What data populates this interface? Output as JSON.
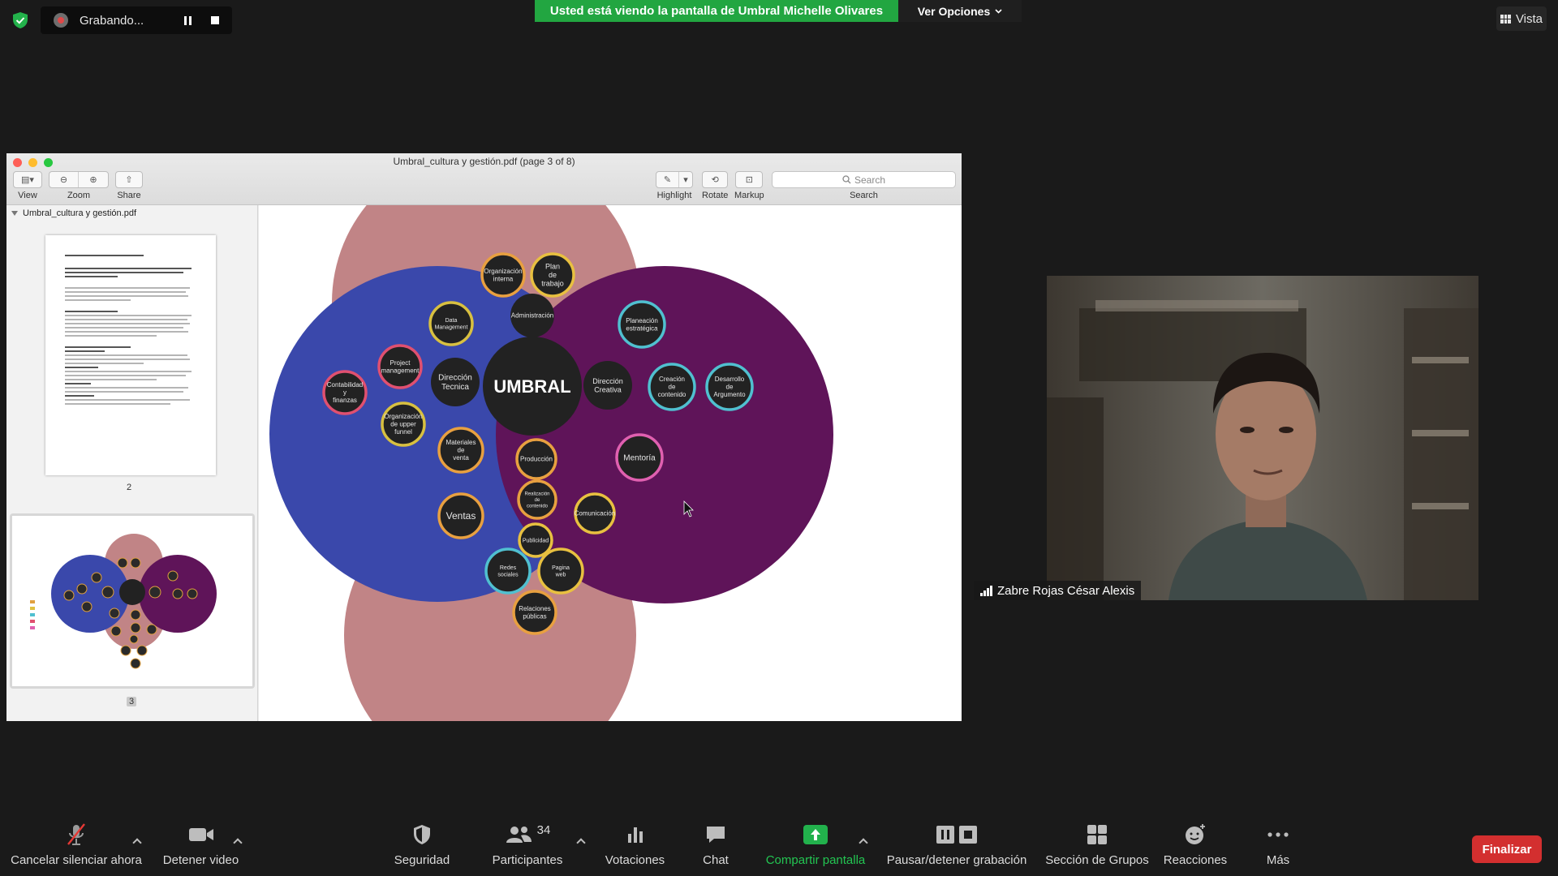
{
  "top": {
    "recording_label": "Grabando...",
    "share_banner": "Usted está viendo la pantalla de Umbral Michelle Olivares",
    "view_options": "Ver Opciones",
    "view_button": "Vista"
  },
  "preview": {
    "window_title": "Umbral_cultura y gestión.pdf (page 3 of 8)",
    "toolbar": {
      "view_label": "View",
      "zoom_label": "Zoom",
      "share_label": "Share",
      "highlight_label": "Highlight",
      "rotate_label": "Rotate",
      "markup_label": "Markup",
      "search_label": "Search",
      "search_placeholder": "Search"
    },
    "sidebar": {
      "filename": "Umbral_cultura y gestión.pdf",
      "page2_label": "2",
      "page3_label": "3"
    }
  },
  "diagram": {
    "center": "UMBRAL",
    "circles": [
      {
        "id": "org-interna",
        "text": "Organización interna"
      },
      {
        "id": "plan-trabajo",
        "text": "Plan de trabajo"
      },
      {
        "id": "administracion",
        "text": "Administración"
      },
      {
        "id": "data-management",
        "text": "Data Management"
      },
      {
        "id": "project-management",
        "text": "Project management"
      },
      {
        "id": "contabilidad",
        "text": "Contabilidad y finanzas"
      },
      {
        "id": "direccion-tecnica",
        "text": "Dirección Tecnica"
      },
      {
        "id": "org-upper-funnel",
        "text": "Organización de upper funnel"
      },
      {
        "id": "materiales-venta",
        "text": "Materiales de venta"
      },
      {
        "id": "direccion-creativa",
        "text": "Dirección Creativa"
      },
      {
        "id": "planeacion-estrategica",
        "text": "Planeación estratégica"
      },
      {
        "id": "creacion-contenido",
        "text": "Creación de contenido"
      },
      {
        "id": "desarrollo-argumento",
        "text": "Desarrollo de Argumento"
      },
      {
        "id": "mentoria",
        "text": "Mentoría"
      },
      {
        "id": "produccion",
        "text": "Producción"
      },
      {
        "id": "realizacion-contenido",
        "text": "Realización de contenido"
      },
      {
        "id": "ventas",
        "text": "Ventas"
      },
      {
        "id": "comunicacion",
        "text": "Comunicación"
      },
      {
        "id": "publicidad",
        "text": "Publicidad"
      },
      {
        "id": "redes-sociales",
        "text": "Redes sociales"
      },
      {
        "id": "pagina-web",
        "text": "Pagina web"
      },
      {
        "id": "relaciones-publicas",
        "text": "Relaciones públicas"
      }
    ],
    "colors": {
      "blue": "#3a48ab",
      "purple": "#5f1459",
      "rose": "#c18486",
      "node": "#222222"
    }
  },
  "camera": {
    "participant_name": "Zabre Rojas César Alexis"
  },
  "bottom": {
    "mute_label": "Cancelar silenciar ahora",
    "video_label": "Detener video",
    "security_label": "Seguridad",
    "participants_label": "Participantes",
    "participants_count": "34",
    "polls_label": "Votaciones",
    "chat_label": "Chat",
    "share_label": "Compartir pantalla",
    "recording_label": "Pausar/detener grabación",
    "breakout_label": "Sección de Grupos",
    "reactions_label": "Reacciones",
    "more_label": "Más",
    "end_label": "Finalizar"
  }
}
